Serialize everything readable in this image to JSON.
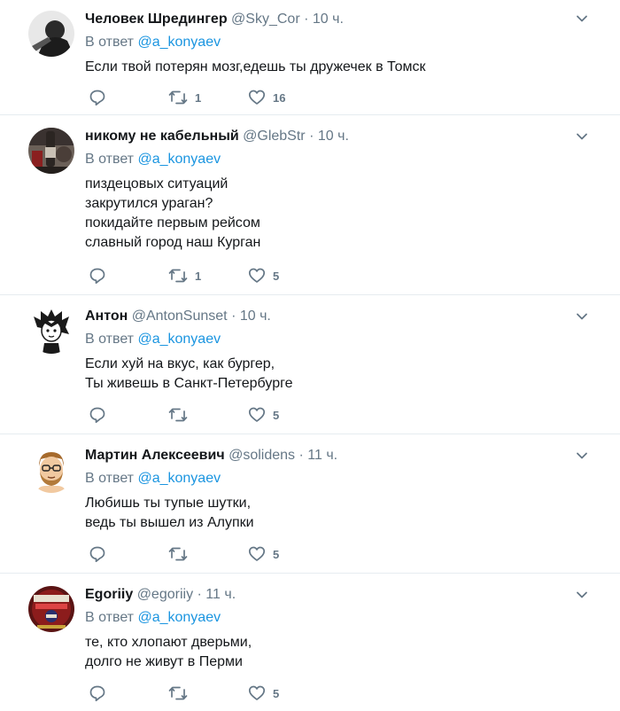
{
  "tweets": [
    {
      "name": "Человек Шредингер",
      "handle": "@Sky_Cor",
      "separator": "·",
      "time": "10 ч.",
      "reply_prefix": "В ответ",
      "reply_mention": "@a_konyaev",
      "lines": [
        "Если твой потерян мозг,едешь ты дружечек в Томск"
      ],
      "retweets": "1",
      "likes": "16"
    },
    {
      "name": "никому не кабельный",
      "handle": "@GlebStr",
      "separator": "·",
      "time": "10 ч.",
      "reply_prefix": "В ответ",
      "reply_mention": "@a_konyaev",
      "lines": [
        "пиздецовых ситуаций",
        "закрутился ураган?",
        "покидайте первым рейсом",
        "славный город наш Курган"
      ],
      "retweets": "1",
      "likes": "5"
    },
    {
      "name": "Антон",
      "handle": "@AntonSunset",
      "separator": "·",
      "time": "10 ч.",
      "reply_prefix": "В ответ",
      "reply_mention": "@a_konyaev",
      "lines": [
        "Если хуй на вкус, как бургер,",
        "Ты живешь в Санкт-Петербурге"
      ],
      "retweets": "",
      "likes": "5"
    },
    {
      "name": "Мартин Алексеевич",
      "handle": "@solidens",
      "separator": "·",
      "time": "11 ч.",
      "reply_prefix": "В ответ",
      "reply_mention": "@a_konyaev",
      "lines": [
        "Любишь ты тупые шутки,",
        "ведь ты вышел из Алупки"
      ],
      "retweets": "",
      "likes": "5"
    },
    {
      "name": "Egoriiy",
      "handle": "@egoriiy",
      "separator": "·",
      "time": "11 ч.",
      "reply_prefix": "В ответ",
      "reply_mention": "@a_konyaev",
      "lines": [
        "те, кто хлопают дверьми,",
        "долго не живут в Перми"
      ],
      "retweets": "",
      "likes": "5"
    }
  ],
  "icons": {
    "reply": "reply-icon",
    "retweet": "retweet-icon",
    "like": "heart-icon",
    "menu": "chevron-down-icon"
  },
  "colors": {
    "mention": "#1b95e0",
    "secondary": "#657786",
    "divider": "#e6ecf0"
  }
}
